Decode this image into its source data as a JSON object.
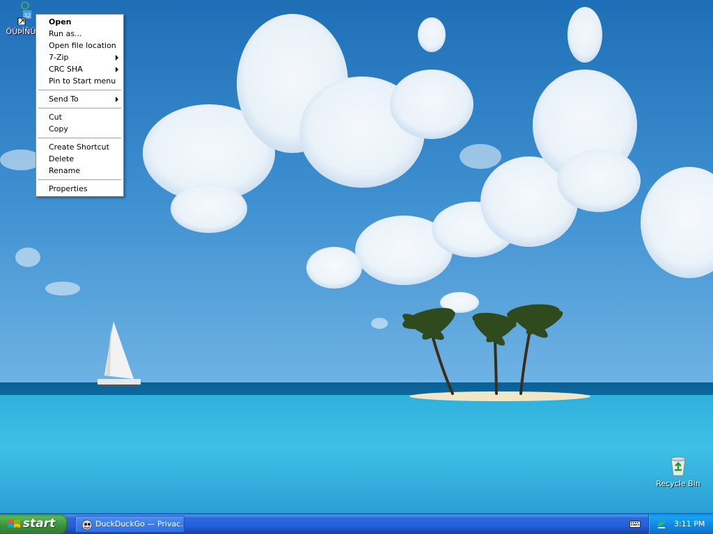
{
  "desktop": {
    "shortcut_label": "ÖÚÞÍÑÜ",
    "shortcut_badge": "32",
    "recycle_bin_label": "Recycle Bin"
  },
  "context_menu": {
    "items": [
      {
        "label": "Open",
        "bold": true,
        "submenu": false
      },
      {
        "label": "Run as...",
        "submenu": false
      },
      {
        "label": "Open file location",
        "submenu": false
      },
      {
        "label": "7-Zip",
        "submenu": true
      },
      {
        "label": "CRC SHA",
        "submenu": true
      },
      {
        "label": "Pin to Start menu",
        "submenu": false
      },
      {
        "label": "Send To",
        "submenu": true
      },
      {
        "label": "Cut",
        "submenu": false
      },
      {
        "label": "Copy",
        "submenu": false
      },
      {
        "label": "Create Shortcut",
        "submenu": false
      },
      {
        "label": "Delete",
        "submenu": false
      },
      {
        "label": "Rename",
        "submenu": false
      },
      {
        "label": "Properties",
        "submenu": false
      }
    ]
  },
  "taskbar": {
    "start_label": "start",
    "task_button_label": "DuckDuckGo — Privac...",
    "clock": "3:11 PM"
  },
  "icons": {
    "shortcut": "shortcut-icon",
    "recycle_bin": "recycle-bin-icon",
    "windows_logo": "windows-logo-icon",
    "browser": "browser-icon",
    "keyboard": "keyboard-icon",
    "network": "network-icon",
    "submenu_arrow": "chevron-right-icon"
  },
  "colors": {
    "taskbar_blue": "#245edb",
    "start_green": "#3a8f3a",
    "selection_blue": "#316ac5",
    "tray_blue": "#0f86e0"
  }
}
